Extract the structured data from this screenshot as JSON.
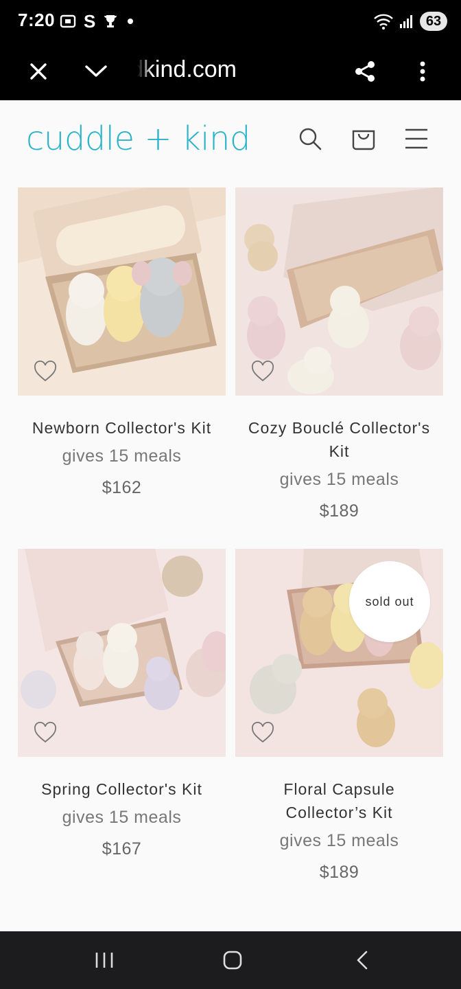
{
  "status_bar": {
    "time": "7:20",
    "carrier_glyph": "S",
    "battery": "63",
    "icons_left": [
      "screenshot-icon",
      "s-app-icon",
      "trophy-icon",
      "dot-icon"
    ],
    "icons_right": [
      "wifi-icon",
      "signal-icon",
      "battery-icon"
    ]
  },
  "browser": {
    "url": "cuddleandkind.com",
    "icons": [
      "close-icon",
      "chevron-down-icon",
      "share-icon",
      "more-vert-icon"
    ]
  },
  "site": {
    "logo": "cuddle + kind",
    "header_icons": [
      "search-icon",
      "cart-icon",
      "menu-icon"
    ]
  },
  "products": [
    {
      "title": "Newborn Collector's Kit",
      "meals": "gives 15 meals",
      "price": "$162",
      "sold_out": false
    },
    {
      "title": "Cozy Bouclé Collector's Kit",
      "meals": "gives 15 meals",
      "price": "$189",
      "sold_out": false
    },
    {
      "title": "Spring Collector's Kit",
      "meals": "gives 15 meals",
      "price": "$167",
      "sold_out": false
    },
    {
      "title": "Floral Capsule Collector’s Kit",
      "meals": "gives 15 meals",
      "price": "$189",
      "sold_out": true,
      "badge": "sold out"
    }
  ],
  "nav": {
    "icons": [
      "recent-apps-icon",
      "home-icon",
      "back-icon"
    ]
  },
  "colors": {
    "brand": "#2bb3c9",
    "page_bg": "#fafafa",
    "browser_bar": "#000000"
  }
}
